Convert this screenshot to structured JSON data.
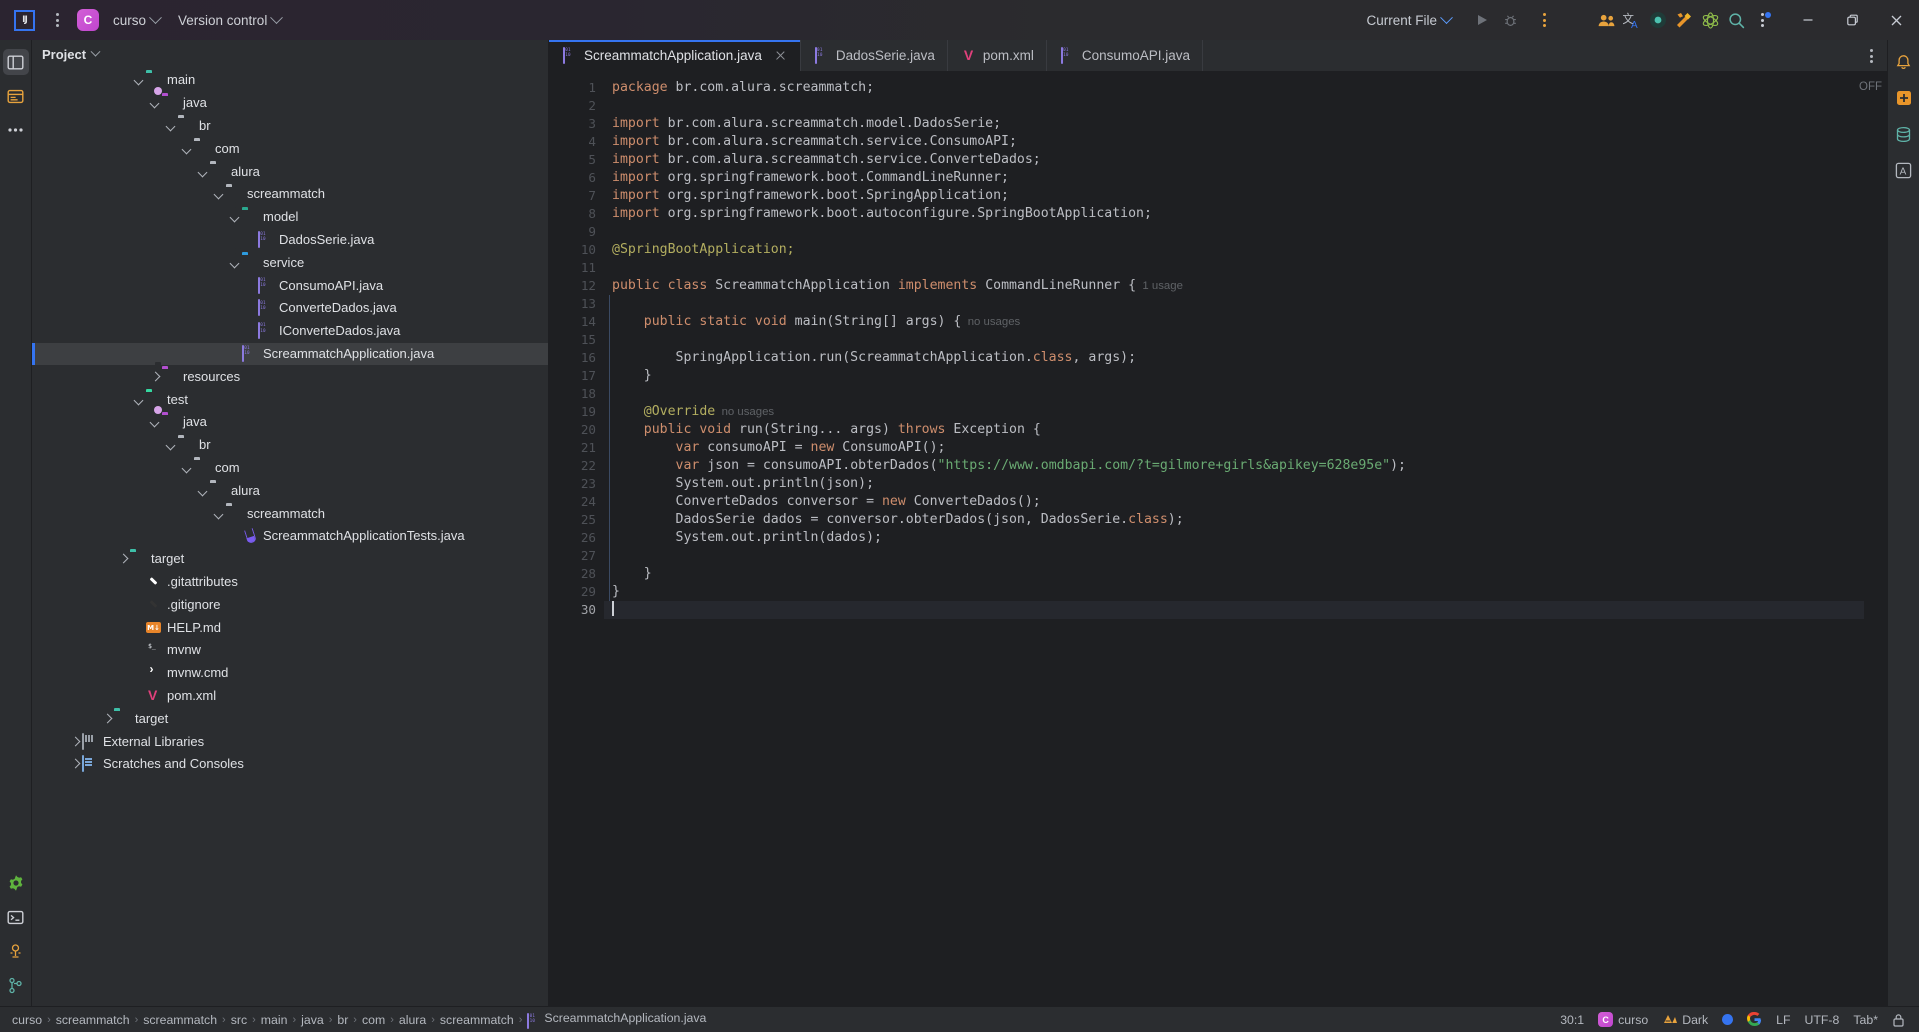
{
  "titlebar": {
    "logo_alt": "IJ",
    "project_initial": "C",
    "project_name": "curso",
    "vcs_label": "Version control",
    "run_config": "Current File",
    "icons": [
      "run-icon",
      "debug-icon",
      "more-actions-icon",
      "collaborate-icon",
      "translate-icon",
      "record-icon",
      "build-tools-icon",
      "atom-icon",
      "search-icon",
      "notifications-kebab-icon"
    ],
    "window_controls": {
      "minimize": "–",
      "maximize": "❐",
      "close": "✕"
    }
  },
  "left_rail": {
    "items": [
      {
        "name": "project-tool-window",
        "icon": "window-icon",
        "active": true
      },
      {
        "name": "commit-tool-window",
        "icon": "commit-icon",
        "active": false
      },
      {
        "name": "more-tool-windows",
        "icon": "ellipsis-icon",
        "active": false
      },
      {
        "name": "settings",
        "icon": "gear-icon",
        "active": false
      },
      {
        "name": "terminal",
        "icon": "terminal-icon",
        "active": false
      },
      {
        "name": "ai-assistant",
        "icon": "assistant-icon",
        "active": false
      },
      {
        "name": "version-control",
        "icon": "branch-icon",
        "active": false
      }
    ]
  },
  "project_panel": {
    "title": "Project",
    "tree": [
      {
        "label": "main",
        "indent": 6,
        "arrow": "down",
        "icon": "source-folder-main"
      },
      {
        "label": "java",
        "indent": 7,
        "arrow": "down",
        "icon": "java-source-folder"
      },
      {
        "label": "br",
        "indent": 8,
        "arrow": "down",
        "icon": "folder"
      },
      {
        "label": "com",
        "indent": 9,
        "arrow": "down",
        "icon": "folder"
      },
      {
        "label": "alura",
        "indent": 10,
        "arrow": "down",
        "icon": "folder"
      },
      {
        "label": "screammatch",
        "indent": 11,
        "arrow": "down",
        "icon": "folder"
      },
      {
        "label": "model",
        "indent": 12,
        "arrow": "down",
        "icon": "package-model"
      },
      {
        "label": "DadosSerie.java",
        "indent": 13,
        "arrow": "none",
        "icon": "java-file"
      },
      {
        "label": "service",
        "indent": 12,
        "arrow": "down",
        "icon": "package-service"
      },
      {
        "label": "ConsumoAPI.java",
        "indent": 13,
        "arrow": "none",
        "icon": "java-file"
      },
      {
        "label": "ConverteDados.java",
        "indent": 13,
        "arrow": "none",
        "icon": "java-file"
      },
      {
        "label": "IConverteDados.java",
        "indent": 13,
        "arrow": "none",
        "icon": "java-file"
      },
      {
        "label": "ScreammatchApplication.java",
        "indent": 12,
        "arrow": "none",
        "icon": "java-file",
        "selected": true
      },
      {
        "label": "resources",
        "indent": 7,
        "arrow": "right",
        "icon": "resources-folder"
      },
      {
        "label": "test",
        "indent": 6,
        "arrow": "down",
        "icon": "source-folder-test"
      },
      {
        "label": "java",
        "indent": 7,
        "arrow": "down",
        "icon": "java-source-folder"
      },
      {
        "label": "br",
        "indent": 8,
        "arrow": "down",
        "icon": "folder"
      },
      {
        "label": "com",
        "indent": 9,
        "arrow": "down",
        "icon": "folder"
      },
      {
        "label": "alura",
        "indent": 10,
        "arrow": "down",
        "icon": "folder"
      },
      {
        "label": "screammatch",
        "indent": 11,
        "arrow": "down",
        "icon": "folder"
      },
      {
        "label": "ScreammatchApplicationTests.java",
        "indent": 12,
        "arrow": "none",
        "icon": "test-file"
      },
      {
        "label": "target",
        "indent": 5,
        "arrow": "right",
        "icon": "target-folder"
      },
      {
        "label": ".gitattributes",
        "indent": 6,
        "arrow": "none",
        "icon": "git-file"
      },
      {
        "label": ".gitignore",
        "indent": 6,
        "arrow": "none",
        "icon": "gitignore-file"
      },
      {
        "label": "HELP.md",
        "indent": 6,
        "arrow": "none",
        "icon": "markdown-file"
      },
      {
        "label": "mvnw",
        "indent": 6,
        "arrow": "none",
        "icon": "shell-file"
      },
      {
        "label": "mvnw.cmd",
        "indent": 6,
        "arrow": "none",
        "icon": "cmd-file"
      },
      {
        "label": "pom.xml",
        "indent": 6,
        "arrow": "none",
        "icon": "maven-file"
      },
      {
        "label": "target",
        "indent": 4,
        "arrow": "right",
        "icon": "target-folder"
      },
      {
        "label": "External Libraries",
        "indent": 2,
        "arrow": "right",
        "icon": "libraries"
      },
      {
        "label": "Scratches and Consoles",
        "indent": 2,
        "arrow": "right",
        "icon": "scratches"
      }
    ]
  },
  "editor": {
    "tabs": [
      {
        "label": "ScreammatchApplication.java",
        "icon": "java-file",
        "active": true,
        "closable": true
      },
      {
        "label": "DadosSerie.java",
        "icon": "java-file",
        "active": false,
        "closable": false
      },
      {
        "label": "pom.xml",
        "icon": "maven-file",
        "active": false,
        "closable": false
      },
      {
        "label": "ConsumoAPI.java",
        "icon": "java-file",
        "active": false,
        "closable": false
      }
    ],
    "inspection_status": "OFF",
    "total_lines": 30,
    "current_line_number": 30,
    "lines": [
      {
        "n": 1,
        "tokens": [
          {
            "t": "package ",
            "c": "kw"
          },
          {
            "t": "br.com.alura.screammatch;",
            "c": "plain"
          }
        ]
      },
      {
        "n": 2,
        "tokens": []
      },
      {
        "n": 3,
        "tokens": [
          {
            "t": "import ",
            "c": "kw"
          },
          {
            "t": "br.com.alura.screammatch.model.DadosSerie;",
            "c": "plain"
          }
        ]
      },
      {
        "n": 4,
        "tokens": [
          {
            "t": "import ",
            "c": "kw"
          },
          {
            "t": "br.com.alura.screammatch.service.ConsumoAPI;",
            "c": "plain"
          }
        ]
      },
      {
        "n": 5,
        "tokens": [
          {
            "t": "import ",
            "c": "kw"
          },
          {
            "t": "br.com.alura.screammatch.service.ConverteDados;",
            "c": "plain"
          }
        ]
      },
      {
        "n": 6,
        "tokens": [
          {
            "t": "import ",
            "c": "kw"
          },
          {
            "t": "org.springframework.boot.CommandLineRunner;",
            "c": "plain"
          }
        ]
      },
      {
        "n": 7,
        "tokens": [
          {
            "t": "import ",
            "c": "kw"
          },
          {
            "t": "org.springframework.boot.SpringApplication;",
            "c": "plain"
          }
        ]
      },
      {
        "n": 8,
        "tokens": [
          {
            "t": "import ",
            "c": "kw"
          },
          {
            "t": "org.springframework.boot.autoconfigure.SpringBootApplication;",
            "c": "plain"
          }
        ]
      },
      {
        "n": 9,
        "tokens": []
      },
      {
        "n": 10,
        "tokens": [
          {
            "t": "@SpringBootApplication;",
            "c": "ann"
          }
        ]
      },
      {
        "n": 11,
        "tokens": []
      },
      {
        "n": 12,
        "tokens": [
          {
            "t": "public ",
            "c": "kw"
          },
          {
            "t": "class ",
            "c": "kw"
          },
          {
            "t": "ScreammatchApplication ",
            "c": "plain"
          },
          {
            "t": "implements ",
            "c": "kw"
          },
          {
            "t": "CommandLineRunner {",
            "c": "plain"
          },
          {
            "t": "  1 usage",
            "c": "hint"
          }
        ]
      },
      {
        "n": 13,
        "tokens": []
      },
      {
        "n": 14,
        "tokens": [
          {
            "t": "    ",
            "c": "plain"
          },
          {
            "t": "public static void ",
            "c": "kw"
          },
          {
            "t": "main(String[] args) {",
            "c": "plain"
          },
          {
            "t": "  no usages",
            "c": "hint"
          }
        ]
      },
      {
        "n": 15,
        "tokens": []
      },
      {
        "n": 16,
        "tokens": [
          {
            "t": "        SpringApplication.run(ScreammatchApplication.",
            "c": "plain"
          },
          {
            "t": "class",
            "c": "kw"
          },
          {
            "t": ", args);",
            "c": "plain"
          }
        ]
      },
      {
        "n": 17,
        "tokens": [
          {
            "t": "    }",
            "c": "plain"
          }
        ]
      },
      {
        "n": 18,
        "tokens": []
      },
      {
        "n": 19,
        "tokens": [
          {
            "t": "    ",
            "c": "plain"
          },
          {
            "t": "@Override",
            "c": "ann"
          },
          {
            "t": "  no usages",
            "c": "hint"
          }
        ]
      },
      {
        "n": 20,
        "tokens": [
          {
            "t": "    ",
            "c": "plain"
          },
          {
            "t": "public void ",
            "c": "kw"
          },
          {
            "t": "run(String... args) ",
            "c": "plain"
          },
          {
            "t": "throws ",
            "c": "kw"
          },
          {
            "t": "Exception {",
            "c": "plain"
          }
        ]
      },
      {
        "n": 21,
        "tokens": [
          {
            "t": "        ",
            "c": "plain"
          },
          {
            "t": "var ",
            "c": "kw"
          },
          {
            "t": "consumoAPI = ",
            "c": "plain"
          },
          {
            "t": "new ",
            "c": "kw"
          },
          {
            "t": "ConsumoAPI();",
            "c": "plain"
          }
        ]
      },
      {
        "n": 22,
        "tokens": [
          {
            "t": "        ",
            "c": "plain"
          },
          {
            "t": "var ",
            "c": "kw"
          },
          {
            "t": "json = consumoAPI.obterDados(",
            "c": "plain"
          },
          {
            "t": "\"https://www.omdbapi.com/?t=gilmore+girls&apikey=628e95e\"",
            "c": "str"
          },
          {
            "t": ");",
            "c": "plain"
          }
        ]
      },
      {
        "n": 23,
        "tokens": [
          {
            "t": "        System.out.println(json);",
            "c": "plain"
          }
        ]
      },
      {
        "n": 24,
        "tokens": [
          {
            "t": "        ConverteDados conversor = ",
            "c": "plain"
          },
          {
            "t": "new ",
            "c": "kw"
          },
          {
            "t": "ConverteDados();",
            "c": "plain"
          }
        ]
      },
      {
        "n": 25,
        "tokens": [
          {
            "t": "        DadosSerie dados = conversor.obterDados(json, DadosSerie.",
            "c": "plain"
          },
          {
            "t": "class",
            "c": "kw"
          },
          {
            "t": ");",
            "c": "plain"
          }
        ]
      },
      {
        "n": 26,
        "tokens": [
          {
            "t": "        System.out.println(dados);",
            "c": "plain"
          }
        ]
      },
      {
        "n": 27,
        "tokens": []
      },
      {
        "n": 28,
        "tokens": [
          {
            "t": "    }",
            "c": "plain"
          }
        ]
      },
      {
        "n": 29,
        "tokens": [
          {
            "t": "}",
            "c": "plain"
          }
        ]
      },
      {
        "n": 30,
        "tokens": [],
        "current": true
      }
    ]
  },
  "right_rail": {
    "items": [
      {
        "name": "notifications",
        "icon": "bell-icon"
      },
      {
        "name": "ai-assistant",
        "icon": "plus-icon"
      },
      {
        "name": "database",
        "icon": "database-icon"
      },
      {
        "name": "bookmarks",
        "icon": "letter-a-icon"
      }
    ]
  },
  "status_bar": {
    "breadcrumbs": [
      "curso",
      "screammatch",
      "screammatch",
      "src",
      "main",
      "java",
      "br",
      "com",
      "alura",
      "screammatch",
      "ScreammatchApplication.java"
    ],
    "breadcrumb_file_icon": "java-file",
    "caret_position": "30:1",
    "project_initial": "C",
    "project_name": "curso",
    "theme": "Dark",
    "theme_icon": "contrast-icon",
    "line_separator": "LF",
    "encoding": "UTF-8",
    "indent": "Tab*",
    "inspection_icon": "inspections-icon",
    "google_icon": "G",
    "lock_icon": "lock-icon"
  },
  "colors": {
    "accent_blue": "#3574f0",
    "bg_dark": "#1e1f22",
    "bg_panel": "#2b2d30",
    "text": "#bcbec4",
    "keyword": "#cf8e6d",
    "string": "#6aab73",
    "annotation": "#b3ae60",
    "selection": "#3d3f42"
  }
}
